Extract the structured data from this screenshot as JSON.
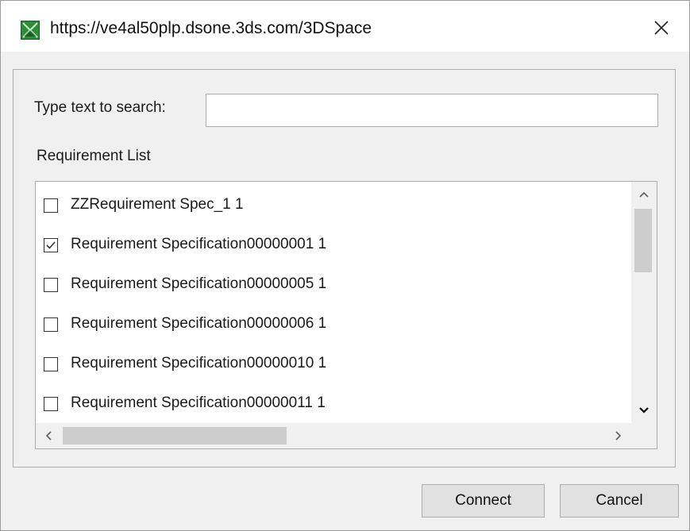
{
  "window": {
    "title": "https://ve4al50plp.dsone.3ds.com/3DSpace",
    "icon": "app-logo-icon",
    "close_icon": "close-icon"
  },
  "search": {
    "label": "Type text to search:",
    "value": "",
    "placeholder": ""
  },
  "requirement_list": {
    "label": "Requirement List",
    "items": [
      {
        "label": "ZZRequirement Spec_1 1",
        "checked": false
      },
      {
        "label": "Requirement Specification00000001 1",
        "checked": true
      },
      {
        "label": "Requirement Specification00000005 1",
        "checked": false
      },
      {
        "label": "Requirement Specification00000006 1",
        "checked": false
      },
      {
        "label": "Requirement Specification00000010 1",
        "checked": false
      },
      {
        "label": "Requirement Specification00000011 1",
        "checked": false
      }
    ]
  },
  "buttons": {
    "connect": "Connect",
    "cancel": "Cancel"
  },
  "colors": {
    "window_bg": "#f0f0f0",
    "accent_green": "#2e8b3a",
    "scroll_thumb": "#cdcdcd"
  }
}
